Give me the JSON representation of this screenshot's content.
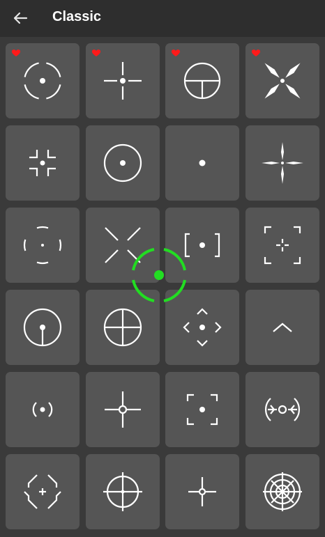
{
  "header": {
    "title": "Classic",
    "back_icon": "arrow-left-icon"
  },
  "colors": {
    "background": "#3a3a3a",
    "appbar": "#2e2e2e",
    "tile": "#555555",
    "favorite": "#ff1a1a",
    "cursor": "#22dd22"
  },
  "crosshairs": [
    {
      "icon": "circle-segments-dot-crosshair-icon",
      "favorite": true
    },
    {
      "icon": "plus-gap-dot-crosshair-icon",
      "favorite": true
    },
    {
      "icon": "circle-t-crosshair-icon",
      "favorite": true
    },
    {
      "icon": "x-spikes-crosshair-icon",
      "favorite": true
    },
    {
      "icon": "corner-brackets-crosshair-icon",
      "favorite": false
    },
    {
      "icon": "circle-dot-crosshair-icon",
      "favorite": false
    },
    {
      "icon": "dot-crosshair-icon",
      "favorite": false
    },
    {
      "icon": "thin-plus-crosshair-icon",
      "favorite": false
    },
    {
      "icon": "arc-segments-dot-crosshair-icon",
      "favorite": false
    },
    {
      "icon": "x-lines-crosshair-icon",
      "favorite": false
    },
    {
      "icon": "square-brackets-dot-crosshair-icon",
      "favorite": false
    },
    {
      "icon": "frame-corners-plus-crosshair-icon",
      "favorite": false
    },
    {
      "icon": "circle-stem-dot-crosshair-icon",
      "favorite": false
    },
    {
      "icon": "circle-plus-crosshair-icon",
      "favorite": false
    },
    {
      "icon": "diamond-chevrons-crosshair-icon",
      "favorite": false
    },
    {
      "icon": "chevron-up-crosshair-icon",
      "favorite": false
    },
    {
      "icon": "parentheses-dot-crosshair-icon",
      "favorite": false
    },
    {
      "icon": "plus-small-circle-crosshair-icon",
      "favorite": false
    },
    {
      "icon": "frame-corners-dot-crosshair-icon",
      "favorite": false
    },
    {
      "icon": "ornate-ring-crosshair-icon",
      "favorite": false
    },
    {
      "icon": "diamond-frame-plus-crosshair-icon",
      "favorite": false
    },
    {
      "icon": "circle-crosshair-icon",
      "favorite": false
    },
    {
      "icon": "plus-ring-crosshair-icon",
      "favorite": false
    },
    {
      "icon": "target-rings-crosshair-icon",
      "favorite": false
    }
  ],
  "overlay": {
    "icon": "touch-cursor-crosshair-icon"
  }
}
